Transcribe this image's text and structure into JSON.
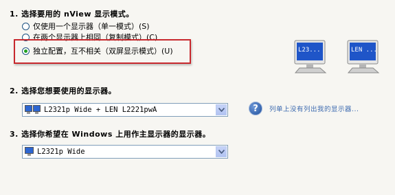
{
  "step1": {
    "heading": "1. 选择要用的 nView 显示模式。",
    "options": [
      {
        "label": "仅使用一个显示器（单一模式）(S)",
        "checked": false
      },
      {
        "label": "在两个显示器上相同（复制模式）(C)",
        "checked": false
      },
      {
        "label": "独立配置，互不相关（双屏显示模式）(U)",
        "checked": true
      }
    ],
    "preview_monitors": [
      {
        "label": "L23..."
      },
      {
        "label": "LEN ..."
      }
    ]
  },
  "step2": {
    "heading": "2. 选择您想要使用的显示器。",
    "select_value": "L2321p Wide + LEN L2221pwA",
    "help_text": "列单上没有列出我的显示器..."
  },
  "step3": {
    "heading": "3. 选择你希望在 Windows 上用作主显示器的显示器。",
    "select_value": "L2321p Wide"
  },
  "colors": {
    "background": "#f7f6f2",
    "highlight": "#c8282d",
    "radio_checked": "#21a121",
    "link": "#3e6bb0"
  }
}
